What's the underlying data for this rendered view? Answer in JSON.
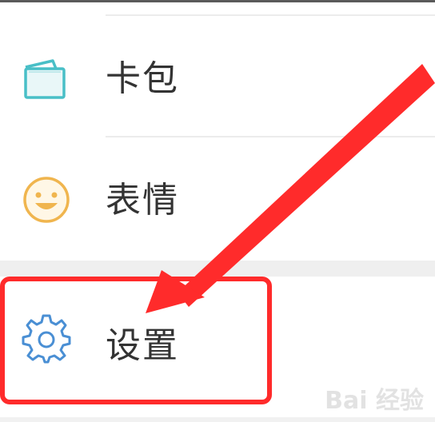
{
  "menu": {
    "items": [
      {
        "label": "卡包",
        "icon": "card-wallet-icon"
      },
      {
        "label": "表情",
        "icon": "smiley-icon"
      },
      {
        "label": "设置",
        "icon": "gear-icon"
      }
    ]
  },
  "annotation": {
    "color": "#ff2b2b"
  },
  "watermark": {
    "text": "Bai 经验"
  }
}
